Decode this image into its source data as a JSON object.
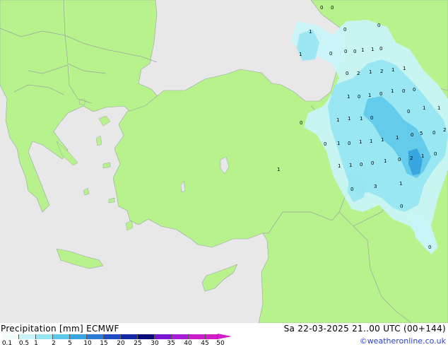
{
  "map": {
    "colors": {
      "land": "#b8f28c",
      "sea": "#e8e8e8",
      "border": "#9aa5a5",
      "precip_light": "#c8f4f8",
      "precip_mid": "#96e6f2",
      "precip_heavy": "#5ec8ea",
      "precip_max": "#3aa6e0"
    },
    "point_values": [
      "0",
      "0",
      "1",
      "0",
      "0",
      "1",
      "0",
      "0",
      "1",
      "1",
      "0",
      "0",
      "0",
      "2",
      "1",
      "2",
      "1",
      "1",
      "1",
      "0",
      "1",
      "0",
      "1",
      "0",
      "0",
      "0",
      "1",
      "1",
      "1",
      "0",
      "0",
      "1",
      "1",
      "0",
      "1",
      "0",
      "1",
      "1",
      "1",
      "1",
      "0",
      "0",
      "5",
      "2",
      "1",
      "1",
      "1",
      "0",
      "0",
      "1",
      "1",
      "2",
      "0",
      "0",
      "0",
      "3",
      "1",
      "0",
      "0"
    ]
  },
  "footer": {
    "title_left": "Precipitation [mm]  ECMWF",
    "title_right": "Sa 22-03-2025 21..00 UTC (00+144)",
    "credit": "©weatheronline.co.uk",
    "legend_ticks": [
      "0.1",
      "0.5",
      "1",
      "2",
      "5",
      "10",
      "15",
      "20",
      "25",
      "30",
      "35",
      "40",
      "45",
      "50"
    ],
    "legend_colors": [
      "#f4fcfc",
      "#c8f4f8",
      "#96e6f2",
      "#5ec8ea",
      "#3aa6e0",
      "#2a7ad4",
      "#1e4cc4",
      "#1428a6",
      "#0a0a7a",
      "#7a14d0",
      "#a81ed6",
      "#c81ec8",
      "#d21ec8"
    ]
  }
}
